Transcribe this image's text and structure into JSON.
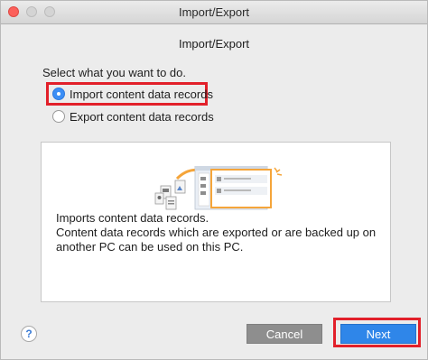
{
  "window": {
    "title": "Import/Export"
  },
  "dialog": {
    "heading": "Import/Export",
    "prompt": "Select what you want to do.",
    "options": [
      {
        "label": "Import content data records",
        "selected": true
      },
      {
        "label": "Export content data records",
        "selected": false
      }
    ],
    "description": [
      "Imports content data records.",
      "Content data records which are exported or are backed up on",
      "another PC can be used on this PC."
    ],
    "help_symbol": "?",
    "cancel_label": "Cancel",
    "next_label": "Next"
  },
  "colors": {
    "accent": "#2f86e9",
    "highlight": "#e2202a",
    "cancel_bg": "#8e8e8e",
    "illustration_orange": "#f5a53a"
  },
  "icons": {
    "window_buttons": [
      "close-traffic-light",
      "minimize-traffic-light",
      "zoom-traffic-light"
    ],
    "illustration": "import-records-illustration"
  }
}
